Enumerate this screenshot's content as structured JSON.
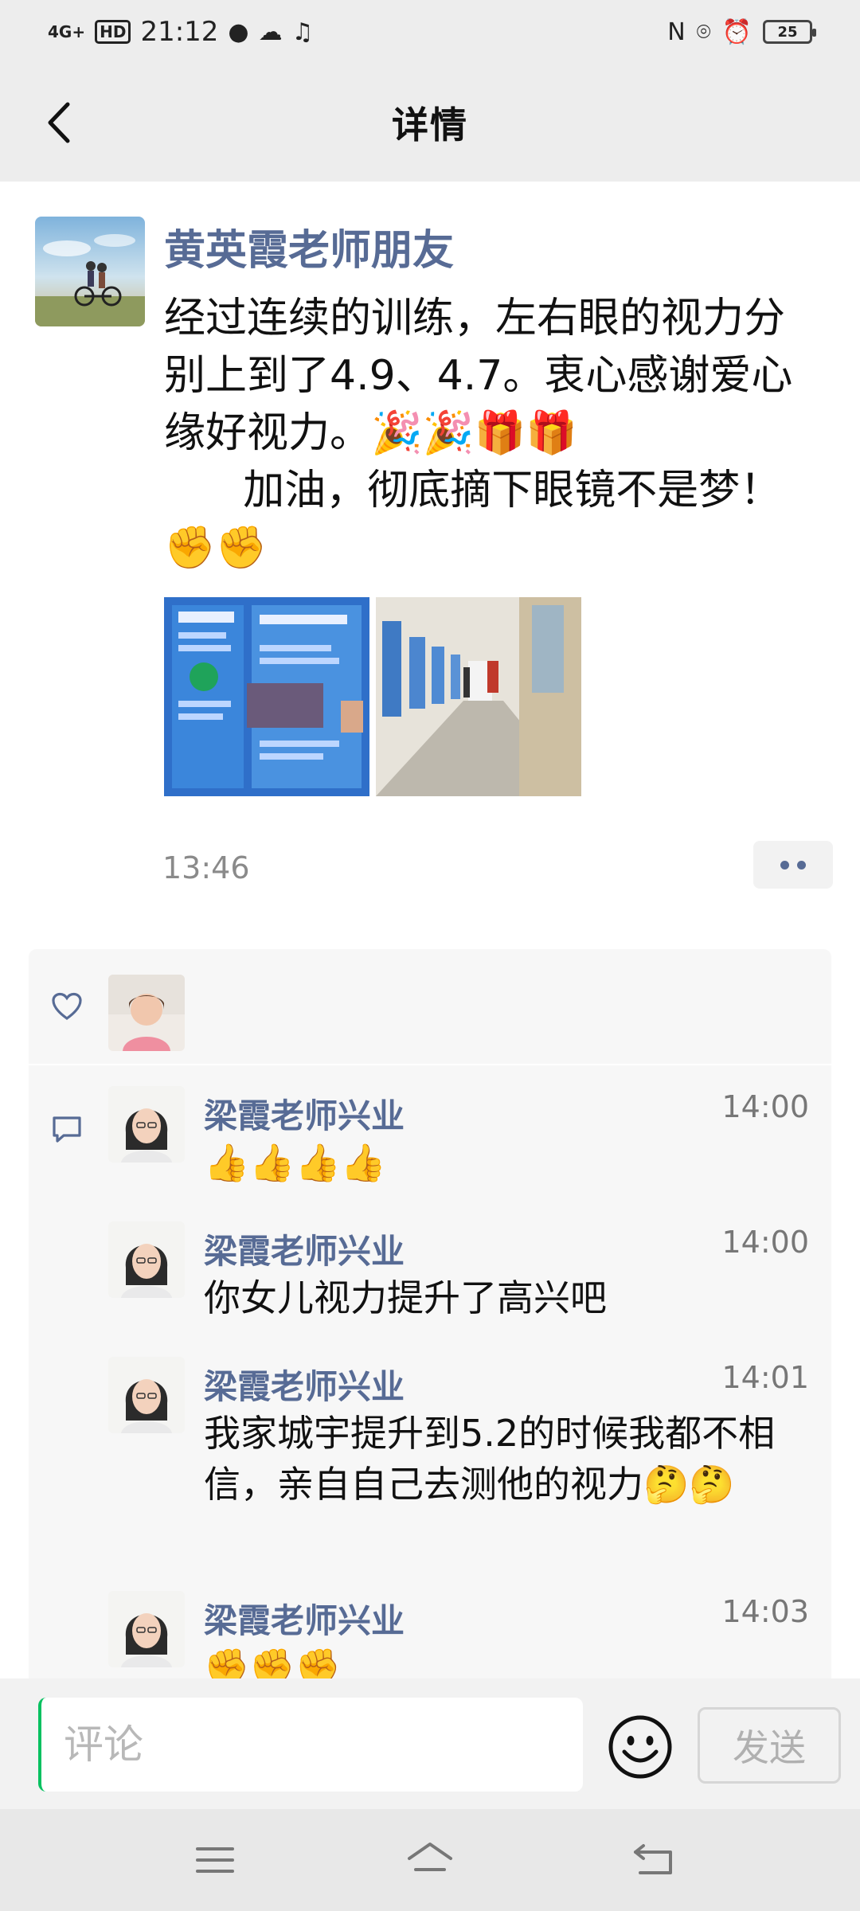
{
  "status_bar": {
    "network": "4G+",
    "hd": "HD",
    "time": "21:12",
    "battery": "25"
  },
  "header": {
    "title": "详情"
  },
  "post": {
    "author": "黄英霞老师朋友",
    "text": "经过连续的训练，左右眼的视力分别上到了4.9、4.7。衷心感谢爱心缘好视力。🎉🎉🎁🎁\n      加油，彻底摘下眼镜不是梦！ ✊✊",
    "time": "13:46"
  },
  "comments": [
    {
      "name": "梁霞老师兴业",
      "time": "14:00",
      "text": "👍👍👍👍"
    },
    {
      "name": "梁霞老师兴业",
      "time": "14:00",
      "text": "你女儿视力提升了高兴吧"
    },
    {
      "name": "梁霞老师兴业",
      "time": "14:01",
      "text": "我家城宇提升到5.2的时候我都不相信，亲自自己去测他的视力🤔🤔"
    },
    {
      "name": "梁霞老师兴业",
      "time": "14:03",
      "text": "✊✊✊"
    }
  ],
  "input_bar": {
    "placeholder": "评论",
    "send_label": "发送"
  },
  "colors": {
    "author_blue": "#576b95",
    "header_bg": "#ededed",
    "panel_bg": "#f7f7f7",
    "cursor_green": "#07c160"
  },
  "icons": [
    "back-icon",
    "heart-icon",
    "comment-icon",
    "emoji-icon",
    "menu-icon",
    "home-icon",
    "return-icon"
  ]
}
